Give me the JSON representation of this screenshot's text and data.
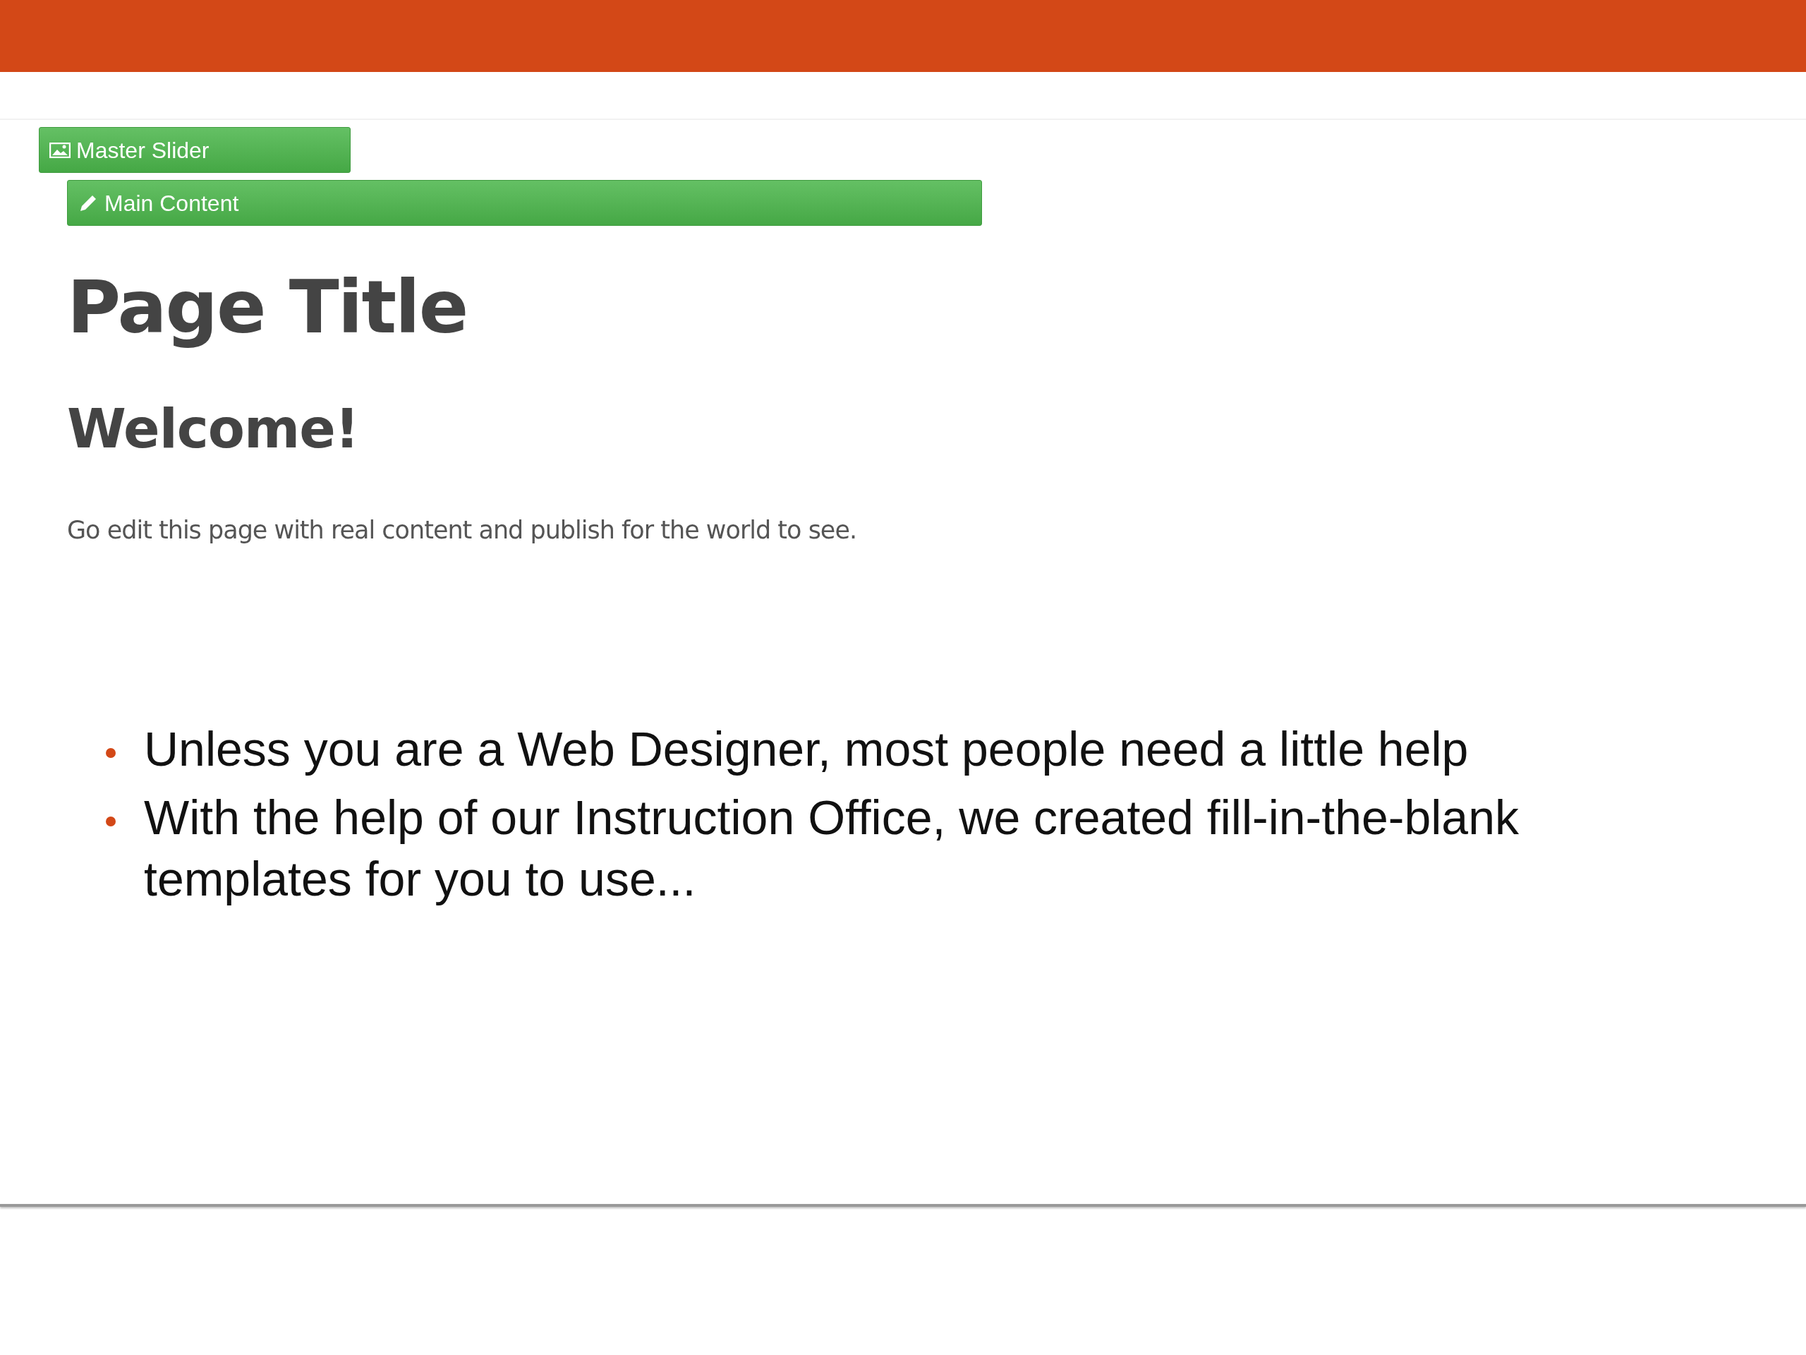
{
  "editor_bars": [
    {
      "kind": "slider",
      "label": "Master Slider"
    },
    {
      "kind": "content",
      "label": "Main Content"
    }
  ],
  "page": {
    "title": "Page Title",
    "heading": "Welcome!",
    "paragraph": "Go edit this page with real content and publish for the world to see."
  },
  "bullets": [
    "Unless you are a Web Designer, most people need a little help",
    "With the help of our Instruction Office, we created fill-in-the-blank templates for you to use..."
  ]
}
